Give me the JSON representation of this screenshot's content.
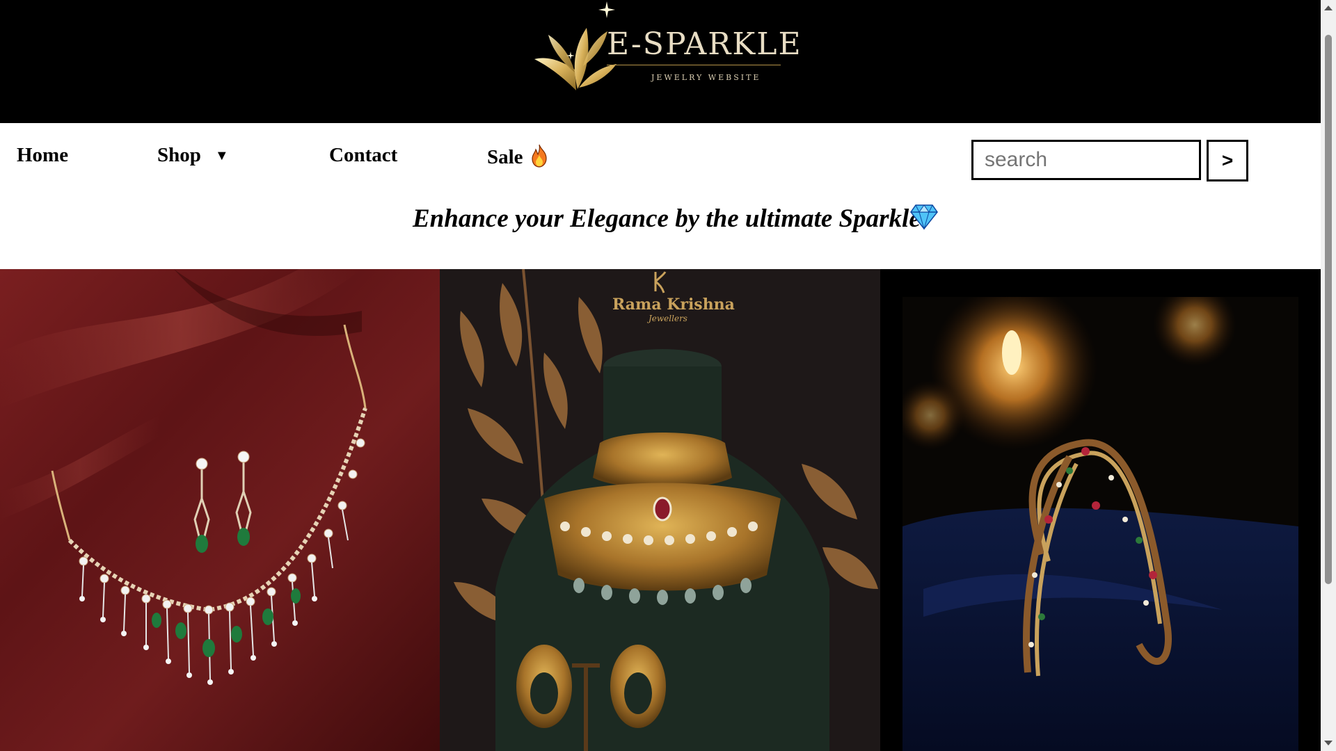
{
  "logo": {
    "name": "E-SPARKLE",
    "subtitle": "JEWELRY   WEBSITE"
  },
  "nav": {
    "items": [
      {
        "label": "Home"
      },
      {
        "label": "Shop",
        "caret": "▼"
      },
      {
        "label": "Contact"
      },
      {
        "label": "Sale",
        "icon": "fire-icon"
      }
    ]
  },
  "search": {
    "placeholder": "search",
    "value": "",
    "button_label": ">"
  },
  "tagline": {
    "text": "Enhance your Elegance by the ultimate Sparkle",
    "icon": "gem-icon"
  },
  "gallery": {
    "photos": [
      {
        "subject": "diamond-emerald-necklace-earrings"
      },
      {
        "subject": "gold-choker-necklace-earrings",
        "brand": "Rama Krishna",
        "brand_sub": "Jewellers"
      },
      {
        "subject": "gemstone-bangles"
      }
    ]
  },
  "colors": {
    "header_bg": "#000000",
    "gold": "#c9a25c",
    "text": "#000000"
  }
}
